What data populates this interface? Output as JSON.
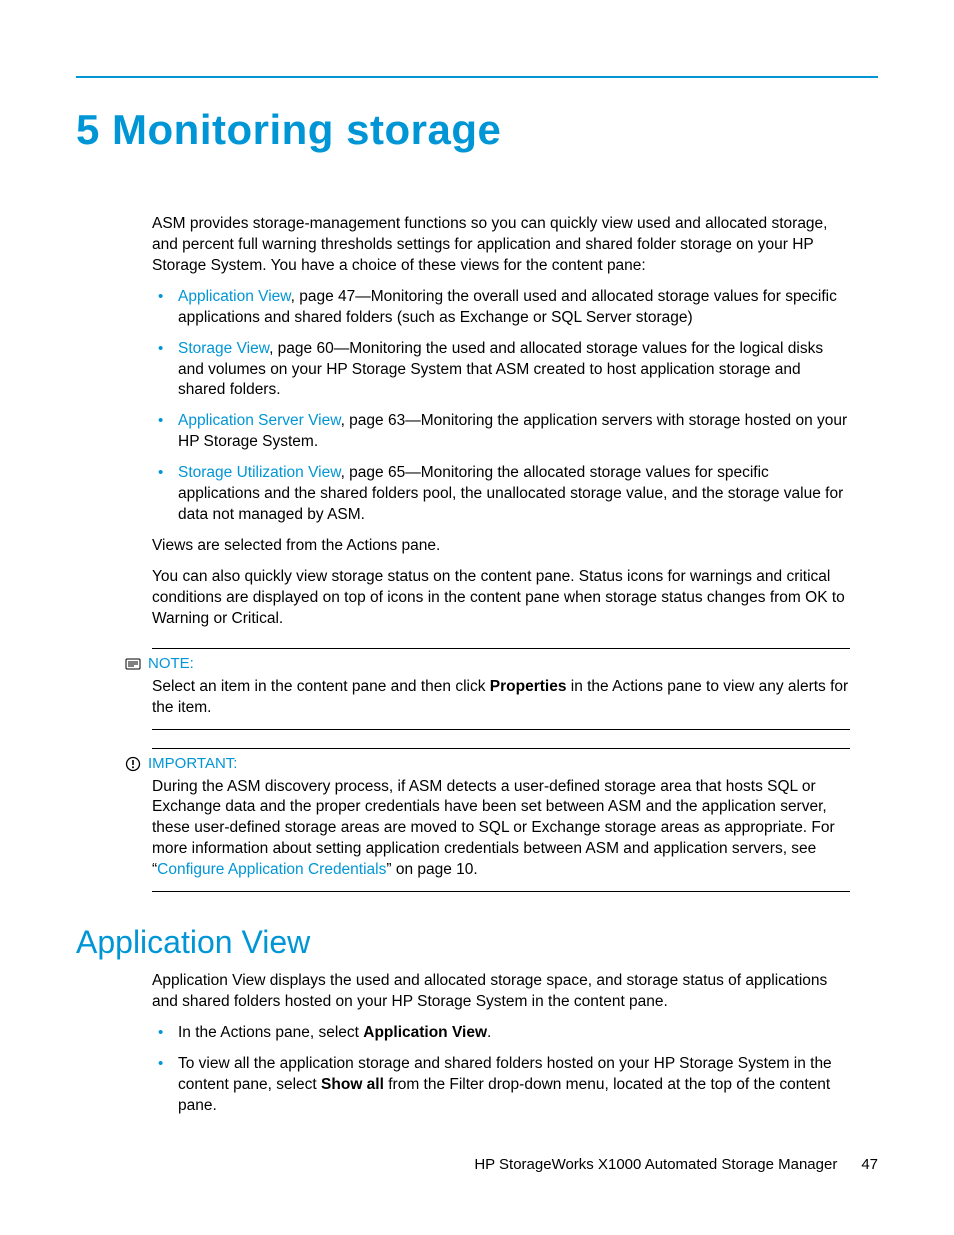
{
  "chapter": {
    "number": "5",
    "title": "Monitoring storage"
  },
  "intro": "ASM provides storage-management functions so you can quickly view used and allocated storage, and percent full warning thresholds settings for application and shared folder storage on your HP Storage System. You have a choice of these views for the content pane:",
  "views": [
    {
      "link": "Application View",
      "rest": ", page 47—Monitoring the overall used and allocated storage values for specific applications and shared folders (such as Exchange or SQL Server storage)"
    },
    {
      "link": "Storage View",
      "rest": ", page 60—Monitoring the used and allocated storage values for the logical disks and volumes on your HP Storage System that ASM created to host application storage and shared folders."
    },
    {
      "link": "Application Server View",
      "rest": ", page 63—Monitoring the application servers with storage hosted on your HP Storage System."
    },
    {
      "link": "Storage Utilization View",
      "rest": ", page 65—Monitoring the allocated storage values for specific applications and the shared folders pool, the unallocated storage value, and the storage value for data not managed by ASM."
    }
  ],
  "after_views_1": "Views are selected from the Actions pane.",
  "after_views_2": "You can also quickly view storage status on the content pane. Status icons for warnings and critical conditions are displayed on top of icons in the content pane when storage status changes from OK to Warning or Critical.",
  "note": {
    "label": "NOTE:",
    "pre": "Select an item in the content pane and then click ",
    "bold": "Properties",
    "post": " in the Actions pane to view any alerts for the item."
  },
  "important": {
    "label": "IMPORTANT:",
    "pre": "During the ASM discovery process, if ASM detects a user-defined storage area that hosts SQL or Exchange data and the proper credentials have been set between ASM and the application server, these user-defined storage areas are moved to SQL or Exchange storage areas as appropriate. For more information about setting application credentials between ASM and application servers, see “",
    "link": "Configure Application Credentials",
    "post": "” on page 10."
  },
  "appview": {
    "heading": "Application View",
    "para": "Application View displays the used and allocated storage space, and storage status of applications and shared folders hosted on your HP Storage System in the content pane.",
    "bullets": [
      {
        "pre": "In the Actions pane, select ",
        "bold": "Application View",
        "post": "."
      },
      {
        "pre": "To view all the application storage and shared folders hosted on your HP Storage System in the content pane, select ",
        "bold": "Show all",
        "post": " from the Filter drop-down menu, located at the top of the content pane."
      }
    ]
  },
  "footer": {
    "title": "HP StorageWorks X1000 Automated Storage Manager",
    "page": "47"
  }
}
